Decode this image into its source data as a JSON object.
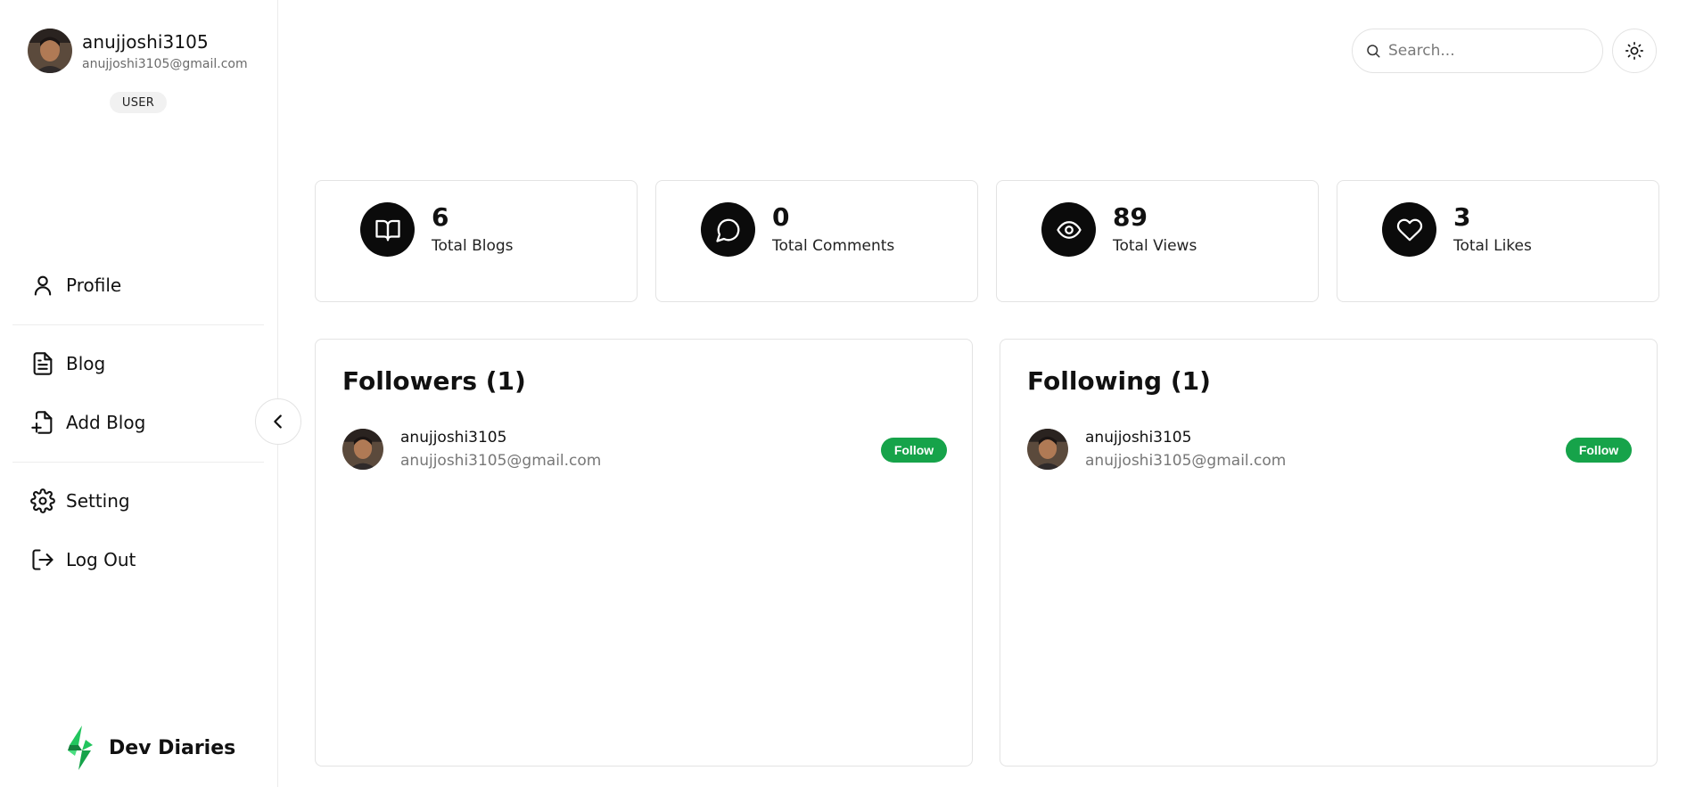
{
  "user": {
    "name": "anujjoshi3105",
    "email": "anujjoshi3105@gmail.com",
    "role": "USER"
  },
  "nav": {
    "profile": "Profile",
    "blog": "Blog",
    "add_blog": "Add Blog",
    "setting": "Setting",
    "logout": "Log Out"
  },
  "brand": {
    "name": "Dev Diaries",
    "accent": "#22c55e"
  },
  "search": {
    "placeholder": "Search..."
  },
  "stats": [
    {
      "value": "6",
      "label": "Total Blogs",
      "icon": "book-open-icon"
    },
    {
      "value": "0",
      "label": "Total Comments",
      "icon": "message-circle-icon"
    },
    {
      "value": "89",
      "label": "Total Views",
      "icon": "eye-icon"
    },
    {
      "value": "3",
      "label": "Total Likes",
      "icon": "heart-icon"
    }
  ],
  "followers": {
    "title": "Followers (1)",
    "items": [
      {
        "name": "anujjoshi3105",
        "email": "anujjoshi3105@gmail.com",
        "action": "Follow"
      }
    ]
  },
  "following": {
    "title": "Following (1)",
    "items": [
      {
        "name": "anujjoshi3105",
        "email": "anujjoshi3105@gmail.com",
        "action": "Follow"
      }
    ]
  },
  "colors": {
    "follow_button": "#16a34a",
    "stat_icon_bg": "#0b0b0b",
    "border": "#e3e3e3"
  }
}
